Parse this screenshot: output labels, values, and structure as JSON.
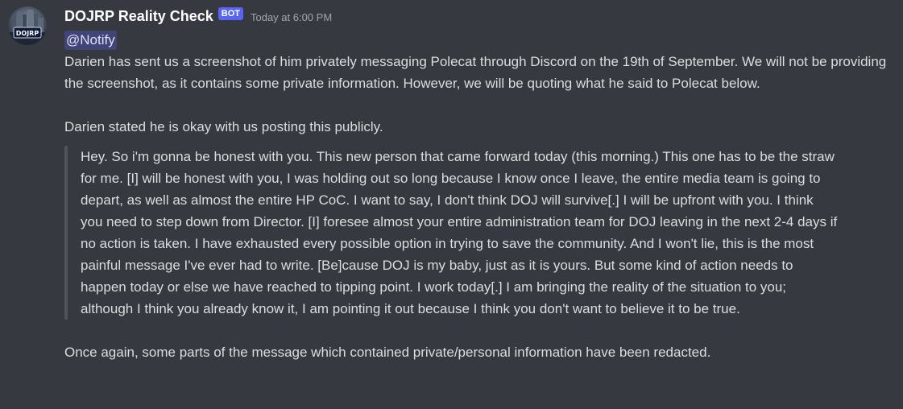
{
  "message": {
    "username": "DOJRP Reality Check",
    "bot_tag": "BOT",
    "timestamp": "Today at 6:00 PM",
    "avatar_text": "DOJRP",
    "mention": "@Notify",
    "paragraph1": "Darien has sent us a screenshot of him privately messaging Polecat through Discord on the 19th of September. We will not be providing the screenshot, as it contains some private information. However, we will be quoting what he said to Polecat below.",
    "paragraph2": "Darien stated he is okay with us posting this publicly.",
    "quote": "Hey. So i'm gonna be honest with you. This new person that came forward today (this morning.) This one has to be the straw for me. [I] will be honest with you, I was holding out so long because I know once I leave, the entire media team is going to depart, as well as almost the entire HP CoC. I want to say, I don't think DOJ will survive[.] I will be upfront with you. I think you need to step down from Director. [I] foresee almost your entire administration team for DOJ leaving in the next 2-4 days if no action is taken. I have exhausted every possible option in trying to save the community. And I won't lie, this is the most painful message I've ever had to write. [Be]cause DOJ is my baby, just as it is yours. But some kind of action needs to happen today or else we have reached to tipping point. I work today[.] I am bringing the reality of the situation to you; although I think you already know it, I am pointing it out because I think you don't want to believe it to be true.",
    "paragraph3": "Once again, some parts of the message which contained private/personal information have been redacted."
  },
  "colors": {
    "background": "#36393f",
    "text": "#dcddde",
    "username": "#ffffff",
    "bot_tag": "#5865f2",
    "timestamp": "#a3a6aa",
    "quote_bar": "#4f545c",
    "mention_text": "#dee0fc"
  }
}
